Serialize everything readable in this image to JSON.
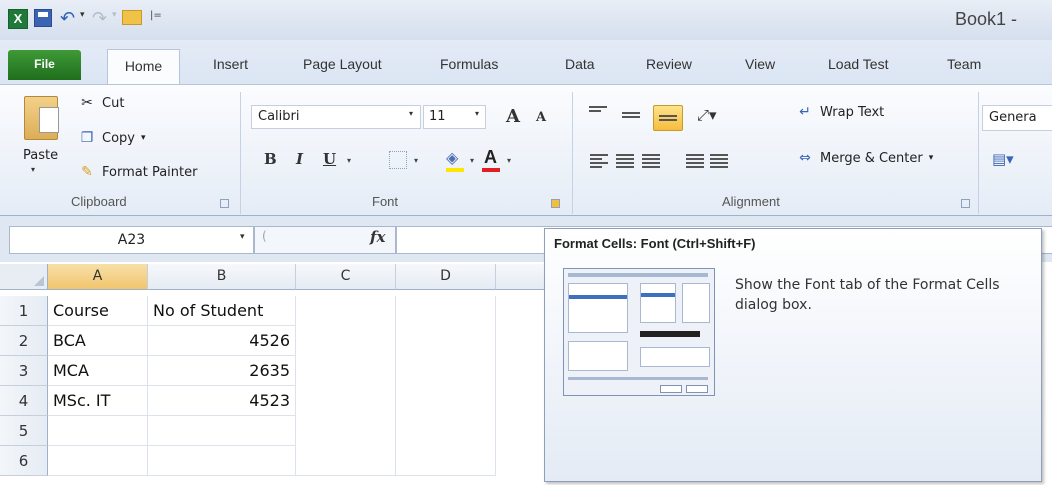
{
  "window": {
    "title": "Book1 -",
    "qat_separator": "|=",
    "undo_dropdown": "▾",
    "redo_dropdown": "▾",
    "logo_letter": "X"
  },
  "tabs": [
    "File",
    "Home",
    "Insert",
    "Page Layout",
    "Formulas",
    "Data",
    "Review",
    "View",
    "Load Test",
    "Team"
  ],
  "ribbon": {
    "clipboard": {
      "paste": "Paste",
      "cut": "Cut",
      "copy": "Copy",
      "copy_dropdown": "▾",
      "format_painter": "Format Painter",
      "group_label": "Clipboard"
    },
    "font": {
      "font_name": "Calibri",
      "font_size": "11",
      "grow_font": "A",
      "shrink_font": "A",
      "bold": "B",
      "italic": "I",
      "underline": "U",
      "fill_color": "#ffe600",
      "font_color": "#e02020",
      "group_label": "Font"
    },
    "alignment": {
      "wrap_text": "Wrap Text",
      "merge_center": "Merge & Center",
      "merge_dropdown": "▾",
      "group_label": "Alignment"
    },
    "number": {
      "format": "Genera"
    }
  },
  "formula_bar": {
    "name_box": "A23",
    "fx": "fx",
    "cancel": "x",
    "formula": ""
  },
  "sheet": {
    "columns": [
      "A",
      "B",
      "C",
      "D"
    ],
    "active_column": "A",
    "rows": [
      "1",
      "2",
      "3",
      "4",
      "5",
      "6"
    ],
    "cells": [
      [
        "Course",
        "No of Student"
      ],
      [
        "BCA",
        "4526"
      ],
      [
        "MCA",
        "2635"
      ],
      [
        "MSc. IT",
        "4523"
      ],
      [
        "",
        ""
      ],
      [
        "",
        ""
      ]
    ]
  },
  "tooltip": {
    "title": "Format Cells: Font (Ctrl+Shift+F)",
    "description": "Show the Font tab of the Format Cells dialog box."
  },
  "colors": {
    "file_tab": "#2e8b2a",
    "highlight_button": "#f6bd3c",
    "active_header": "#f1c56c"
  }
}
